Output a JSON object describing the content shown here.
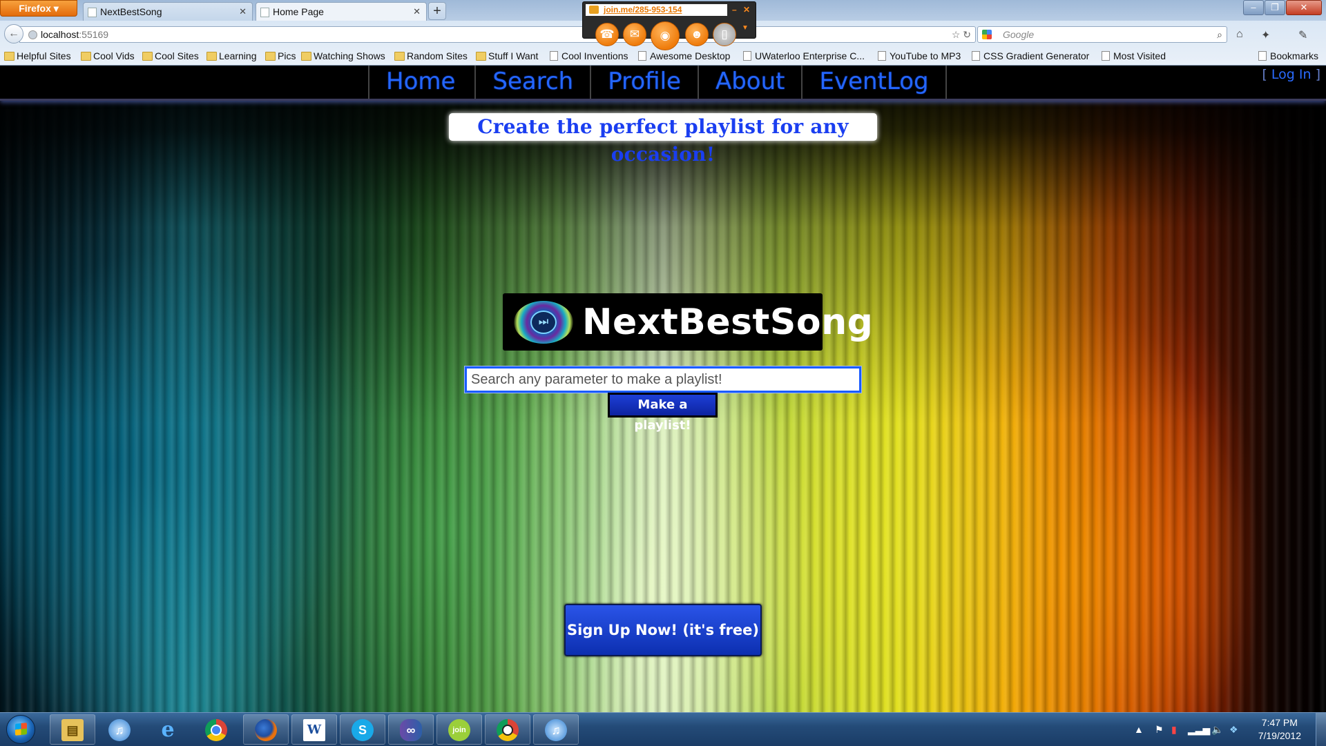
{
  "browser": {
    "app_button": "Firefox",
    "tabs": [
      {
        "title": "NextBestSong",
        "active": false
      },
      {
        "title": "Home Page",
        "active": true
      }
    ],
    "new_tab_label": "+",
    "address": {
      "host": "localhost",
      "port": ":55169"
    },
    "search_placeholder": "Google",
    "bookmarks": [
      {
        "label": "Helpful Sites",
        "type": "folder"
      },
      {
        "label": "Cool Vids",
        "type": "folder"
      },
      {
        "label": "Cool Sites",
        "type": "folder"
      },
      {
        "label": "Learning",
        "type": "folder"
      },
      {
        "label": "Pics",
        "type": "folder"
      },
      {
        "label": "Watching Shows",
        "type": "folder"
      },
      {
        "label": "Random Sites",
        "type": "folder"
      },
      {
        "label": "Stuff I Want",
        "type": "folder"
      },
      {
        "label": "Cool Inventions",
        "type": "page"
      },
      {
        "label": "Awesome Desktop",
        "type": "page"
      },
      {
        "label": "UWaterloo Enterprise C...",
        "type": "page"
      },
      {
        "label": "YouTube to MP3",
        "type": "page"
      },
      {
        "label": "CSS Gradient Generator",
        "type": "page"
      },
      {
        "label": "Most Visited",
        "type": "page"
      }
    ],
    "bookmarks_menu": "Bookmarks"
  },
  "joinme": {
    "url": "join.me/285-953-154",
    "buttons": [
      "phone-icon",
      "chat-icon",
      "broadcast-icon",
      "user-icon",
      "mouse-icon"
    ]
  },
  "site": {
    "nav": [
      "Home",
      "Search",
      "Profile",
      "About",
      "EventLog"
    ],
    "login": {
      "open": "[",
      "label": "Log In",
      "close": "]"
    },
    "tagline": "Create the perfect playlist for any occasion!",
    "brand": "NextBestSong",
    "search_placeholder": "Search any parameter to make a playlist!",
    "search_value": "",
    "make_playlist_label": "Make a playlist!",
    "signup_label": "Sign Up Now! (it's free)",
    "colors": {
      "accent": "#1a3ef0",
      "nav_text": "#2467ff",
      "button": "#1d3fd6"
    }
  },
  "taskbar": {
    "apps": [
      "explorer-icon",
      "itunes-icon",
      "internet-explorer-icon",
      "chrome-icon",
      "firefox-icon",
      "word-icon",
      "skype-icon",
      "app-icon",
      "joinme-icon",
      "chrome-soccer-icon",
      "itunes-icon"
    ],
    "time": "7:47 PM",
    "date": "7/19/2012"
  }
}
